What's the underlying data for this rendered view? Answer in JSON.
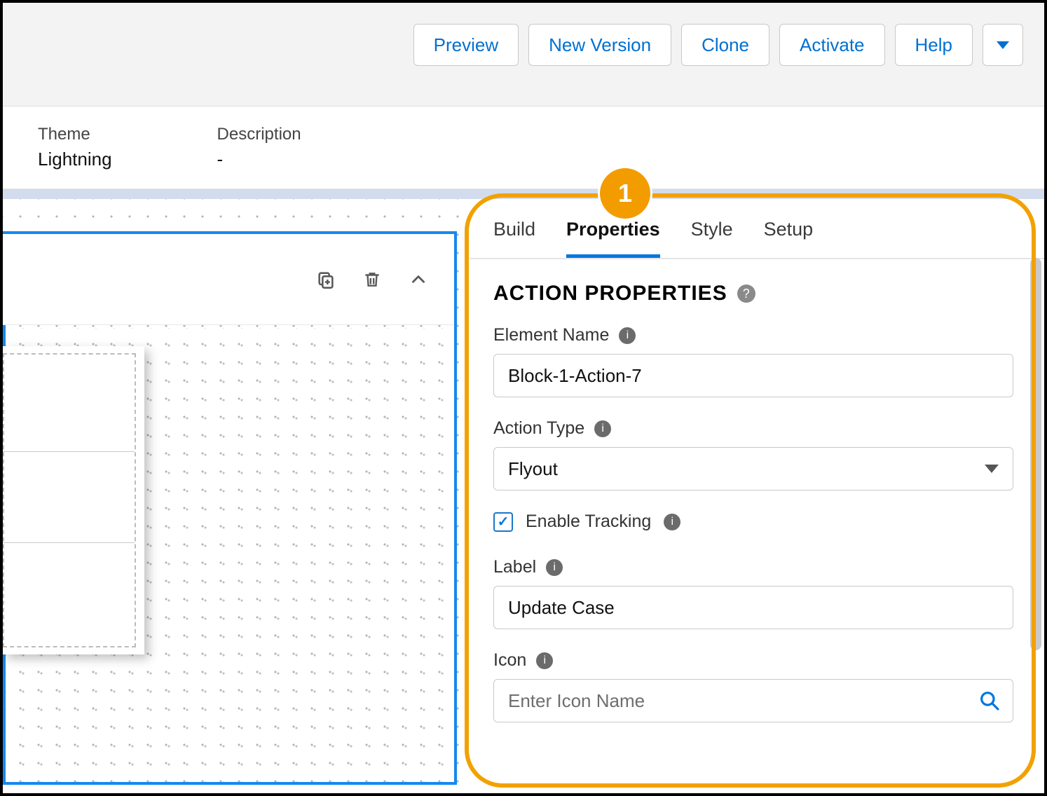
{
  "toolbar": {
    "preview": "Preview",
    "new_version": "New Version",
    "clone": "Clone",
    "activate": "Activate",
    "help": "Help"
  },
  "info": {
    "theme_label": "Theme",
    "theme_value": "Lightning",
    "desc_label": "Description",
    "desc_value": "-"
  },
  "tabs": {
    "build": "Build",
    "properties": "Properties",
    "style": "Style",
    "setup": "Setup"
  },
  "panel": {
    "title": "ACTION PROPERTIES",
    "element_name_label": "Element Name",
    "element_name_value": "Block-1-Action-7",
    "action_type_label": "Action Type",
    "action_type_value": "Flyout",
    "enable_tracking_label": "Enable Tracking",
    "enable_tracking_checked": true,
    "label_label": "Label",
    "label_value": "Update Case",
    "icon_label": "Icon",
    "icon_placeholder": "Enter Icon Name"
  },
  "callout": {
    "badge": "1"
  }
}
